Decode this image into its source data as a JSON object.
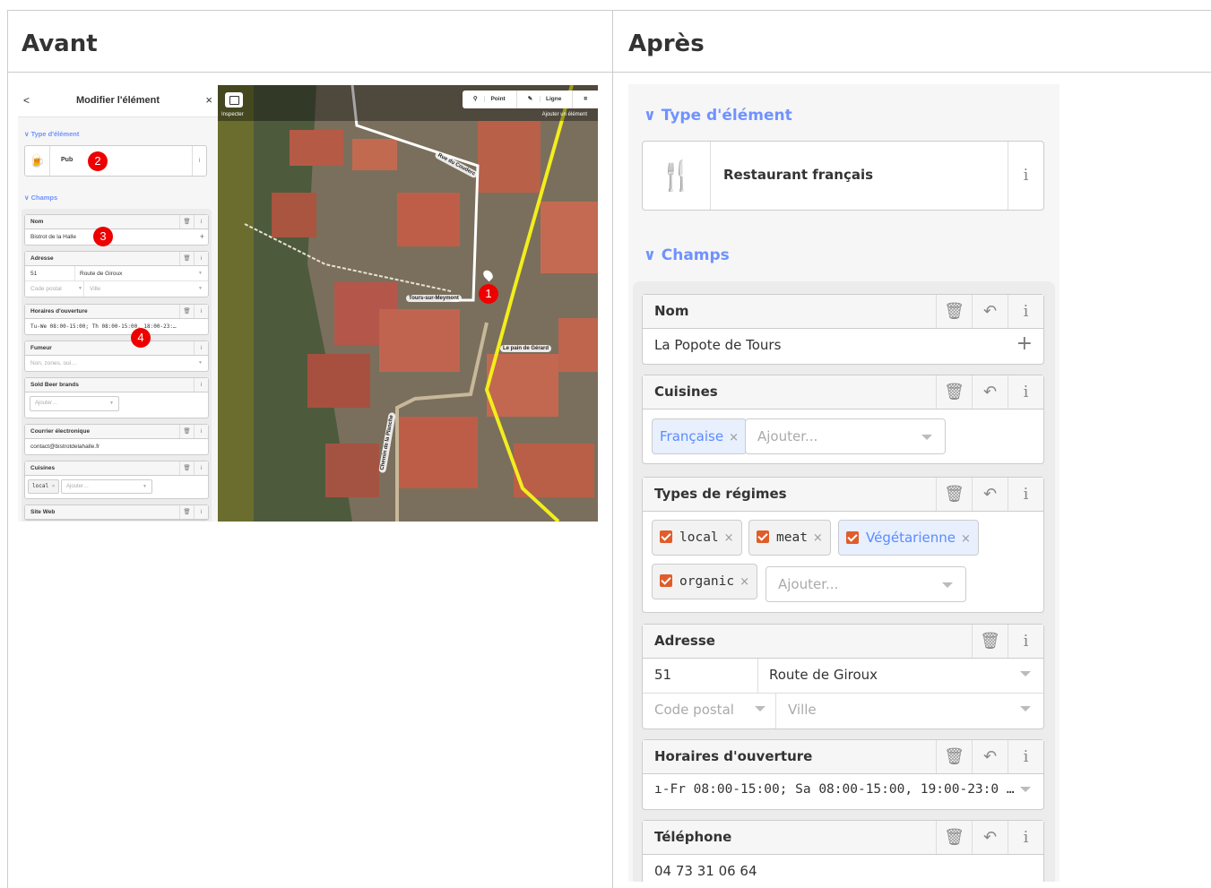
{
  "before": {
    "title": "Avant",
    "sidebar": {
      "header_title": "Modifier l'élément",
      "back": "<",
      "close": "×",
      "section_type": "Type d'élément",
      "preset_name": "Pub",
      "section_fields": "Champs",
      "fields": {
        "name_label": "Nom",
        "name_value": "Bistrot de la Halle",
        "address_label": "Adresse",
        "address_number": "51",
        "address_street": "Route de Giroux",
        "address_postcode_placeholder": "Code postal",
        "address_city_placeholder": "Ville",
        "hours_label": "Horaires d'ouverture",
        "hours_value": "Tu-We 08:00-15:00; Th 08:00-15:00, 18:00-23:…",
        "smoking_label": "Fumeur",
        "smoking_placeholder": "Non, zones, oui…",
        "beer_label": "Sold Beer brands",
        "beer_placeholder": "Ajouter…",
        "email_label": "Courrier électronique",
        "email_value": "contact@bistrotdelahalle.fr",
        "cuisine_label": "Cuisines",
        "cuisine_chip": "local",
        "cuisine_placeholder": "Ajouter…",
        "website_label": "Site Web"
      }
    },
    "map": {
      "inspect_label": "Inspecter",
      "add_label": "Ajouter un élément",
      "toolbar": {
        "point": "Point",
        "line": "Ligne"
      },
      "streets": {
        "rue_couderc": "Rue du Couderc",
        "tours": "Tours-sur-Meymont",
        "pain": "Le pain de Gérard",
        "chemin": "Chemin de la Planche"
      }
    },
    "badges": [
      "1",
      "2",
      "3",
      "4"
    ]
  },
  "after": {
    "title": "Après",
    "section_type": "Type d'élément",
    "preset_name": "Restaurant français",
    "section_fields": "Champs",
    "fields": {
      "name_label": "Nom",
      "name_value": "La Popote de Tours",
      "cuisine_label": "Cuisines",
      "cuisine_chip": "Française",
      "cuisine_placeholder": "Ajouter...",
      "diet_label": "Types de régimes",
      "diet_chips": [
        "local",
        "meat",
        "Végétarienne",
        "organic"
      ],
      "diet_placeholder": "Ajouter...",
      "address_label": "Adresse",
      "address_number": "51",
      "address_street": "Route de Giroux",
      "address_postcode_placeholder": "Code postal",
      "address_city_placeholder": "Ville",
      "hours_label": "Horaires d'ouverture",
      "hours_value": "ı-Fr 08:00-15:00; Sa 08:00-15:00, 19:00-23:0 …",
      "phone_label": "Téléphone",
      "phone_value": "04 73 31 06 64"
    }
  },
  "icons": {
    "info": "i",
    "delete": "🗑",
    "undo": "↶",
    "plus": "+",
    "remove": "×",
    "chevron": "∨"
  },
  "colors": {
    "accent": "#7092ff",
    "badge": "#ee0000",
    "checkbox": "#e05d2b",
    "road_yellow": "#f2ee1c"
  }
}
